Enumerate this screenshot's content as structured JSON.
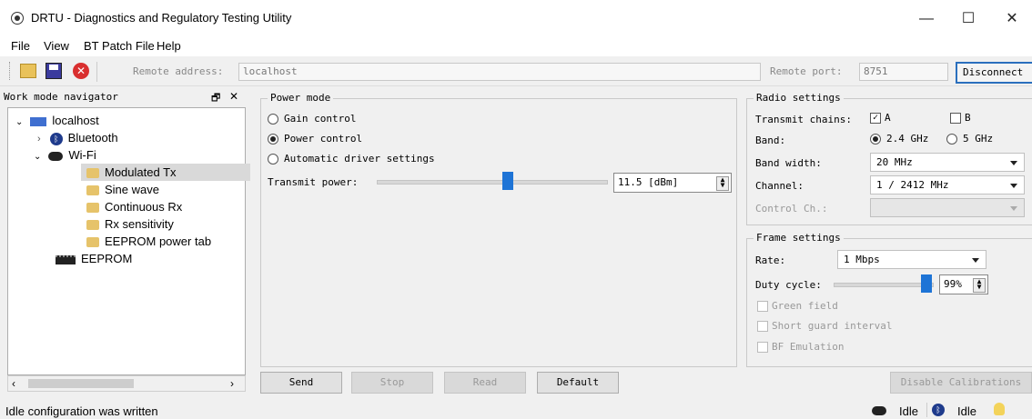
{
  "window": {
    "title": "DRTU - Diagnostics and Regulatory Testing Utility",
    "minimize_glyph": "—",
    "maximize_glyph": "☐",
    "close_glyph": "✕"
  },
  "menu": [
    "File",
    "View",
    "BT Patch File",
    "Help"
  ],
  "toolbar": {
    "remote_address_label": "Remote address:",
    "remote_address_value": "localhost",
    "remote_port_label": "Remote port:",
    "remote_port_value": "8751",
    "disconnect_label": "Disconnect",
    "icons": [
      "open-icon",
      "save-icon",
      "stop-icon"
    ]
  },
  "navigator": {
    "title": "Work mode navigator",
    "pin_glyph": "🗗",
    "close_glyph": "✕",
    "tree": {
      "root": "localhost",
      "bluetooth": "Bluetooth",
      "wifi": "Wi-Fi",
      "wifi_items": [
        "Modulated Tx",
        "Sine wave",
        "Continuous Rx",
        "Rx sensitivity",
        "EEPROM power tab"
      ],
      "selected": "Modulated Tx",
      "eeprom": "EEPROM"
    }
  },
  "power_mode": {
    "legend": "Power mode",
    "options": [
      {
        "label": "Gain control",
        "selected": false
      },
      {
        "label": "Power control",
        "selected": true
      },
      {
        "label": "Automatic driver settings",
        "selected": false
      }
    ],
    "transmit_power_label": "Transmit power:",
    "transmit_power_value": "11.5 [dBm]",
    "transmit_power_slider_fraction": 0.55
  },
  "radio_settings": {
    "legend": "Radio settings",
    "transmit_chains_label": "Transmit chains:",
    "chain_a_label": "A",
    "chain_a_checked": true,
    "chain_b_label": "B",
    "chain_b_checked": false,
    "band_label": "Band:",
    "band_options": [
      {
        "label": "2.4 GHz",
        "selected": true
      },
      {
        "label": "5 GHz",
        "selected": false
      }
    ],
    "bandwidth_label": "Band width:",
    "bandwidth_value": "20 MHz",
    "channel_label": "Channel:",
    "channel_value": "1 / 2412 MHz",
    "control_ch_label": "Control Ch.:"
  },
  "frame_settings": {
    "legend": "Frame settings",
    "rate_label": "Rate:",
    "rate_value": "1 Mbps",
    "duty_cycle_label": "Duty cycle:",
    "duty_cycle_value": "99%",
    "duty_cycle_fraction": 0.99,
    "green_field": "Green field",
    "short_guard": "Short guard interval",
    "bf_emulation": "BF Emulation"
  },
  "buttons": {
    "send": "Send",
    "stop": "Stop",
    "read": "Read",
    "default": "Default",
    "disable_calibrations": "Disable Calibrations"
  },
  "status": {
    "message": "Idle configuration was written",
    "wifi_status": "Idle",
    "bt_status": "Idle"
  }
}
